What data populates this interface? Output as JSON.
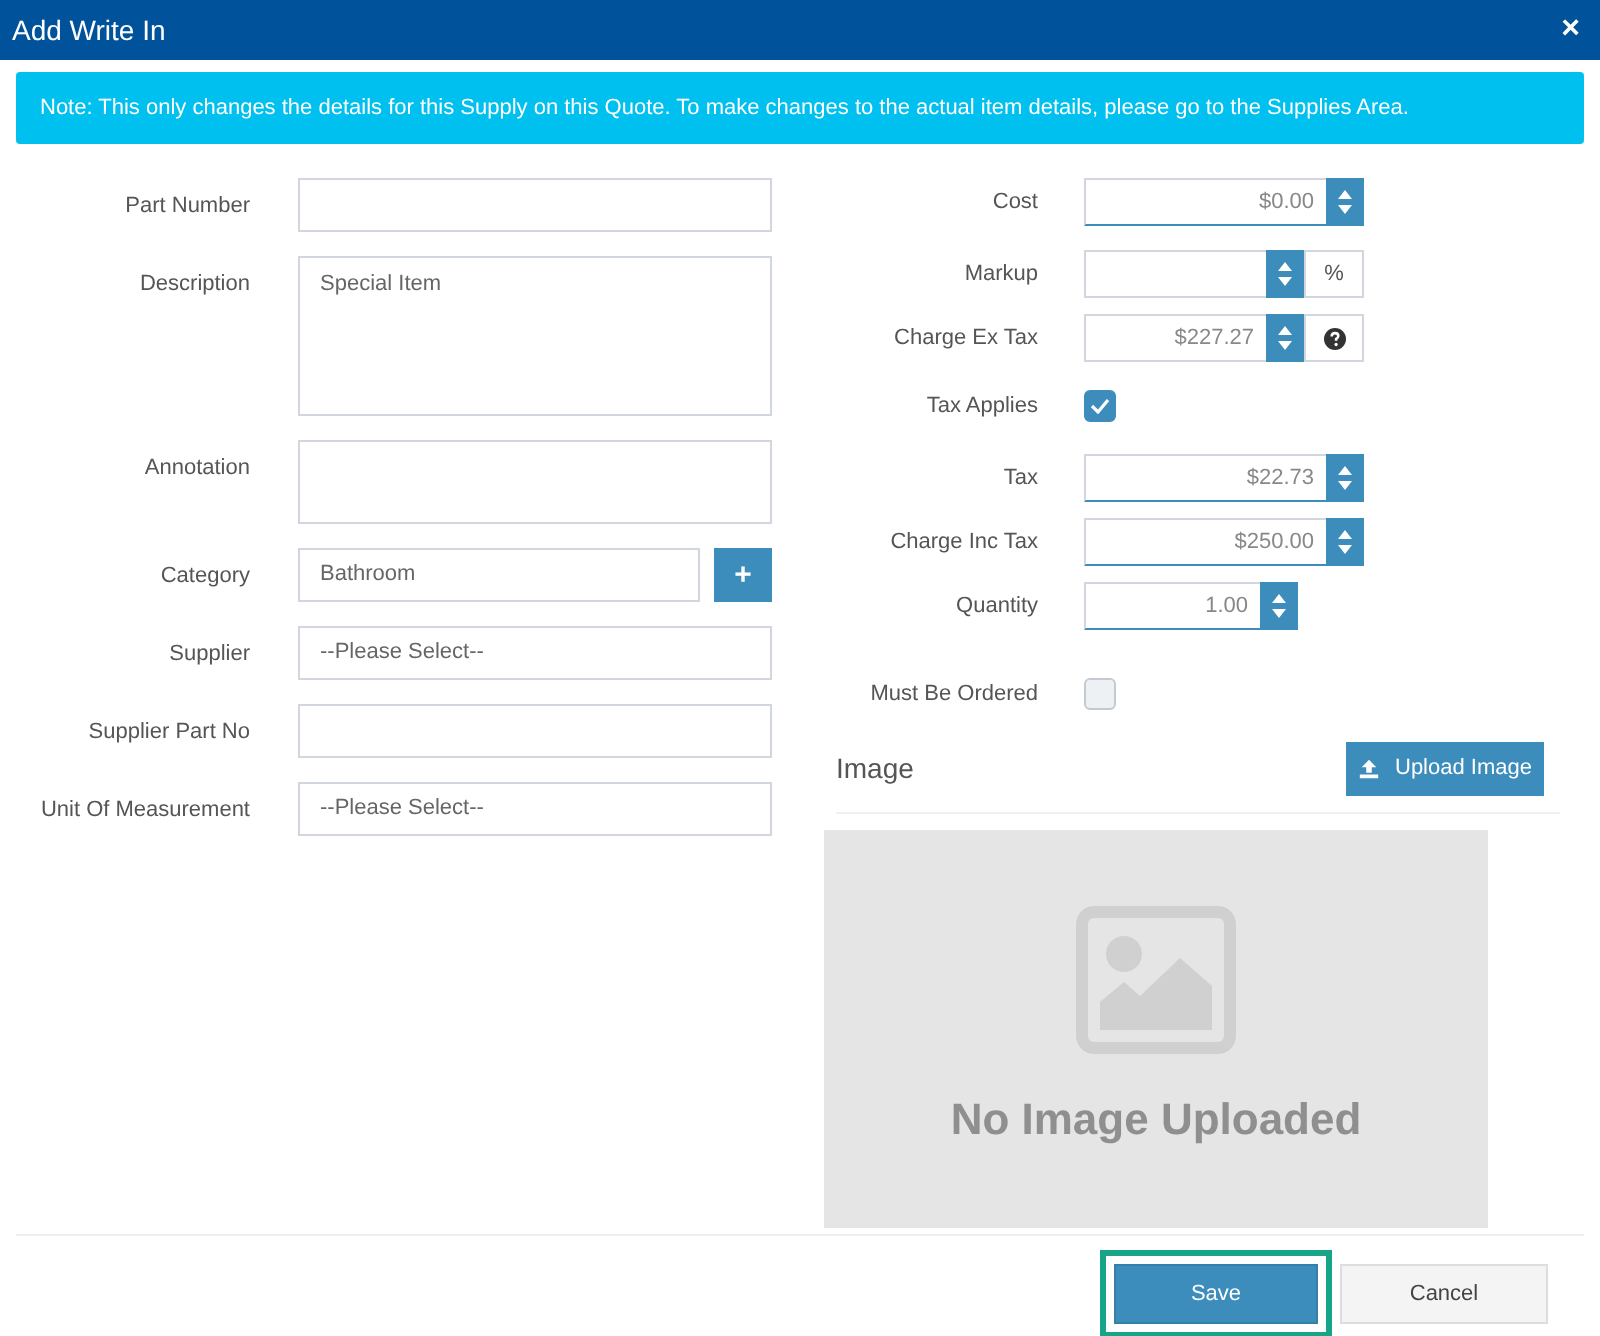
{
  "window": {
    "title": "Add Write In",
    "close": "×"
  },
  "note": "Note: This only changes the details for this Supply on this Quote. To make changes to the actual item details, please go to the Supplies Area.",
  "left_fields": [
    {
      "kind": "text",
      "label": "Part Number"
    },
    {
      "kind": "textarea",
      "label": "Description",
      "value": "Special Item"
    },
    {
      "kind": "textarea_small",
      "label": "Annotation"
    },
    {
      "kind": "select_add",
      "label": "Category",
      "value": "Bathroom",
      "add": "+"
    },
    {
      "kind": "select",
      "label": "Supplier",
      "value": "--Please Select--"
    },
    {
      "kind": "text",
      "label": "Supplier Part No"
    },
    {
      "kind": "select",
      "label": "Unit Of Measurement",
      "value": "--Please Select--"
    }
  ],
  "right_fields": [
    {
      "kind": "number",
      "label": "Cost",
      "value": "$0.00"
    },
    {
      "kind": "number_addon",
      "label": "Markup",
      "addon": "%"
    },
    {
      "kind": "number_help",
      "label": "Charge Ex Tax",
      "value": "$227.27"
    },
    {
      "kind": "checkbox",
      "label": "Tax Applies",
      "checked": true
    },
    {
      "kind": "number",
      "label": "Tax",
      "value": "$22.73"
    },
    {
      "kind": "number",
      "label": "Charge Inc Tax",
      "value": "$250.00"
    },
    {
      "kind": "number_short",
      "label": "Quantity",
      "value": "1.00"
    },
    {
      "kind": "checkbox",
      "label": "Must Be Ordered",
      "checked": false
    }
  ],
  "image": {
    "heading": "Image",
    "upload_button": "Upload Image",
    "placeholder_text": "No Image Uploaded"
  },
  "buttons": [
    {
      "label": "Save",
      "kind": "primary",
      "highlighted": true
    },
    {
      "label": "Cancel",
      "kind": "secondary",
      "highlighted": false
    }
  ]
}
